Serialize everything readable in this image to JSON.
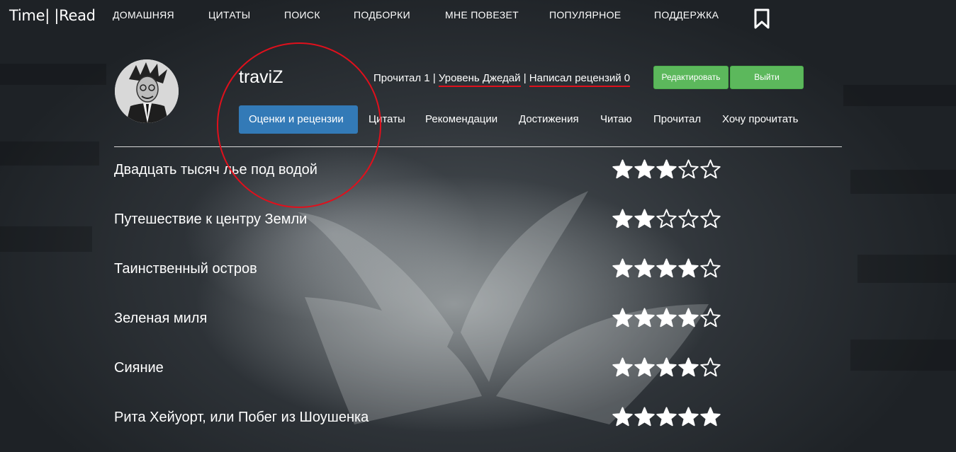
{
  "brand": "Time| |Read",
  "nav": {
    "items": [
      {
        "label": "ДОМАШНЯЯ"
      },
      {
        "label": "ЦИТАТЫ"
      },
      {
        "label": "ПОИСК"
      },
      {
        "label": "ПОДБОРКИ"
      },
      {
        "label": "МНЕ ПОВЕЗЕТ"
      },
      {
        "label": "ПОПУЛЯРНОЕ"
      },
      {
        "label": "ПОДДЕРЖКА"
      }
    ],
    "bookmark_icon": "bookmark-icon"
  },
  "profile": {
    "username": "traviZ",
    "stats": {
      "read": "Прочитал 1",
      "sep1": "|",
      "level": "Уровень Джедай",
      "sep2": "|",
      "reviews": "Написал рецензий 0"
    },
    "edit_label": "Редактировать",
    "logout_label": "Выйти",
    "avatar_icon": "user-avatar"
  },
  "tabs": [
    {
      "label": "Оценки и рецензии",
      "active": true
    },
    {
      "label": "Цитаты",
      "active": false
    },
    {
      "label": "Рекомендации",
      "active": false
    },
    {
      "label": "Достижения",
      "active": false
    },
    {
      "label": "Читаю",
      "active": false
    },
    {
      "label": "Прочитал",
      "active": false
    },
    {
      "label": "Хочу прочитать",
      "active": false
    }
  ],
  "ratings": [
    {
      "title": "Двадцать тысяч лье под водой",
      "stars": 3,
      "max": 5
    },
    {
      "title": "Путешествие к центру Земли",
      "stars": 2,
      "max": 5
    },
    {
      "title": "Таинственный остров",
      "stars": 4,
      "max": 5
    },
    {
      "title": "Зеленая миля",
      "stars": 4,
      "max": 5
    },
    {
      "title": "Сияние",
      "stars": 4,
      "max": 5
    },
    {
      "title": "Рита Хейуорт, или Побег из Шоушенка",
      "stars": 5,
      "max": 5
    }
  ],
  "colors": {
    "accent_tab": "#337ab7",
    "button_green": "#5cb85c",
    "annotation_red": "#e0101c"
  }
}
